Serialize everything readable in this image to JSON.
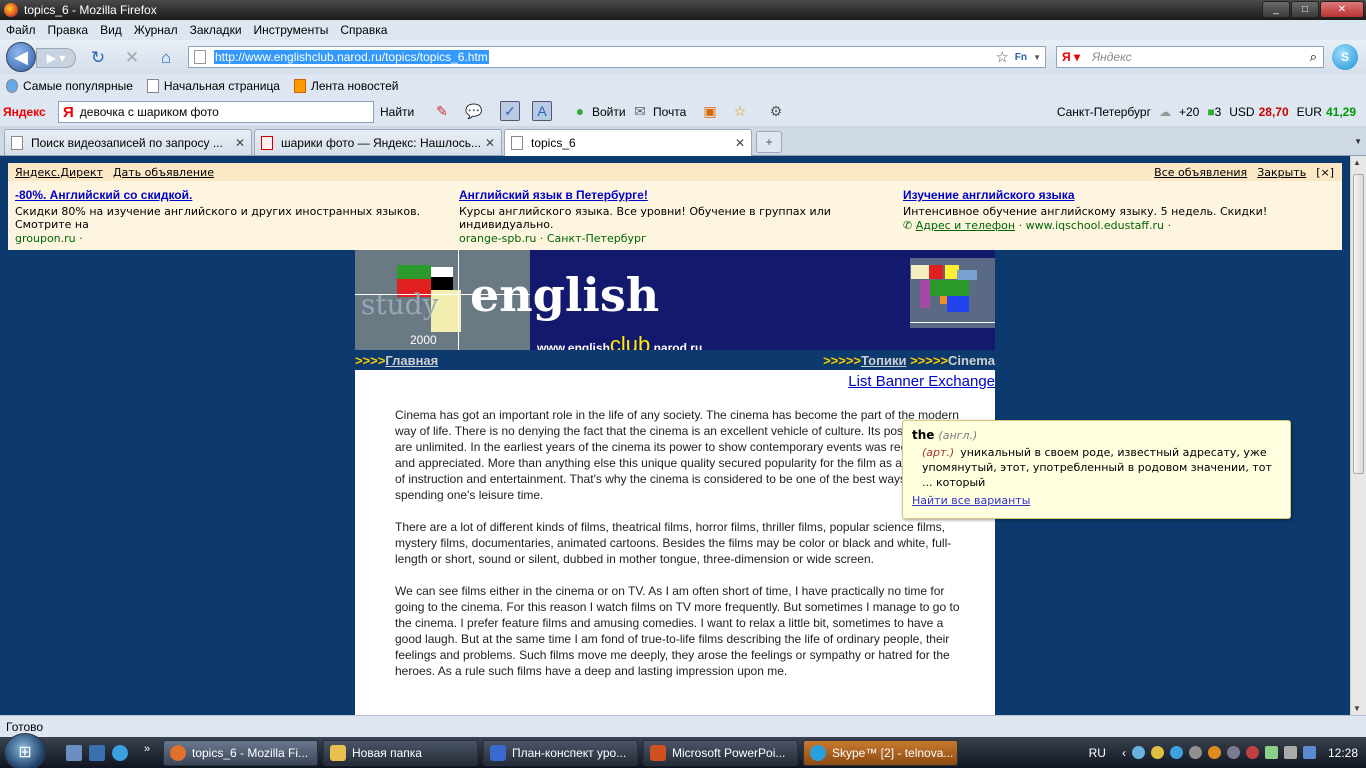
{
  "window": {
    "title": "topics_6 - Mozilla Firefox"
  },
  "menu": [
    "Файл",
    "Правка",
    "Вид",
    "Журнал",
    "Закладки",
    "Инструменты",
    "Справка"
  ],
  "nav": {
    "url": "http://www.englishclub.narod.ru/topics/topics_6.htm",
    "search_placeholder": "Яндекс"
  },
  "bookmarks": [
    "Самые популярные",
    "Начальная страница",
    "Лента новостей"
  ],
  "yandex_bar": {
    "logo": "Яндекс",
    "query": "девочка с шариком фото",
    "find_label": "Найти",
    "enter_label": "Войти",
    "mail_label": "Почта",
    "city": "Санкт-Петербург",
    "weather": "+20",
    "traffic": "3",
    "usd_label": "USD",
    "usd": "28,70",
    "eur_label": "EUR",
    "eur": "41,29"
  },
  "tabs": [
    {
      "label": "Поиск видеозаписей по запросу ..."
    },
    {
      "label": "шарики фото — Яндекс: Нашлось..."
    },
    {
      "label": "topics_6"
    }
  ],
  "ads": {
    "source": "Яндекс.Директ",
    "post_ad": "Дать объявление",
    "all_ads": "Все объявления",
    "close": "Закрыть",
    "close_x": "[×]",
    "items": [
      {
        "title": "-80%. Английский со скидкой.",
        "text": "Скидки 80% на изучение английского и других иностранных языков. Смотрите на",
        "url": "groupon.ru  ·"
      },
      {
        "title": "Английский язык в Петербурге!",
        "text": "Курсы английского языка. Все уровни! Обучение в группах или индивидуально.",
        "url": "orange-spb.ru  ·  Санкт-Петербург"
      },
      {
        "title": "Изучение английского языка",
        "text": "Интенсивное обучение английскому языку. 5 недель. Скидки!",
        "link": "Адрес и телефон",
        "url": "·  www.iqschool.edustaff.ru  ·"
      }
    ]
  },
  "banner": {
    "study": "study",
    "english": "english",
    "year": "2000",
    "site_pre": "www.english",
    "site_club": "club",
    "site_post": ".narod.ru"
  },
  "page_nav": {
    "arrows_left": ">>>>",
    "home": "Главная",
    "arrows_mid": ">>>>>",
    "topics": "Топики",
    "arrows_right": ">>>>>",
    "current": "Cinema"
  },
  "list_banner": "List Banner Exchange",
  "article": [
    "Cinema has got an important role in the life of any society. The cinema has become the part of the modern way of life. There is no denying the fact that the cinema is an excellent vehicle of culture. Its possibilities are unlimited. In the earliest years of the cinema its power to show contemporary events was recognized and appreciated. More than anything else this unique quality secured popularity for the film as a new form of instruction and entertainment. That's why the cinema is considered to be one of the best ways of spending one's leisure time.",
    "There are a lot of different kinds of films, theatrical films, horror films, thriller films, popular science films, mystery films, documentaries, animated cartoons. Besides the films may be color or black and white, full-length or short, sound or silent, dubbed in mother tongue, three-dimension or wide screen.",
    "We can see films either in the cinema or on TV. As I am often short of time, I have practically no time for going to the cinema. For this reason I watch films on TV more frequently. But sometimes I manage to go to the cinema. I prefer feature films and amusing comedies. I want to relax a little bit, sometimes to have a good laugh. But at the same time I am fond of true-to-life films describing the life of ordinary people, their feelings and problems. Such films move me deeply, they arose the feelings or sympathy or hatred for the heroes. As a rule such films have a deep and lasting impression upon me."
  ],
  "popup": {
    "word": "the",
    "lang": "(англ.)",
    "pos": "(арт.)",
    "definition": "уникальный в своем роде, известный адресату, уже упомянутый, этот, употребленный в родовом значении, тот ... который",
    "more": "Найти все варианты"
  },
  "status": "Готово",
  "taskbar": {
    "tasks": [
      "topics_6 - Mozilla Fi...",
      "Новая папка",
      "План-конспект уро...",
      "Microsoft PowerPoi...",
      "Skype™ [2] - telnova..."
    ],
    "lang": "RU",
    "time": "12:28"
  }
}
